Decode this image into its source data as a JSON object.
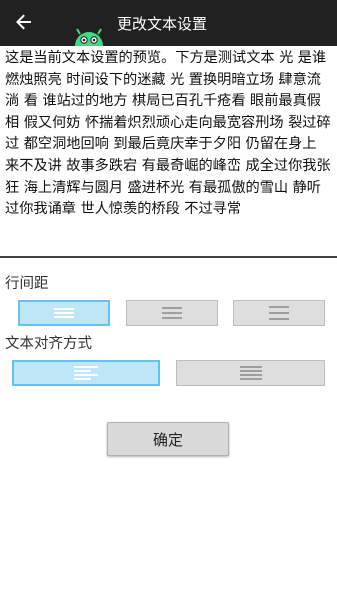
{
  "appbar": {
    "title": "更改文本设置",
    "back_icon": "arrow-left-icon",
    "logo_icon": "android-robot-icon"
  },
  "preview": {
    "text": "这是当前文本设置的预览。下方是测试文本 光 是谁燃烛照亮 时间设下的迷藏 光 置换明暗立场 肆意流淌 看 谁站过的地方 棋局已百孔千疮看 眼前最真假相 假又何妨 怀揣着炽烈顽心走向最宽容刑场 裂过碎过 都空洞地回响 到最后竟庆幸于夕阳 仍留在身上 来不及讲 故事多跌宕 有最奇崛的峰峦 成全过你我张狂 海上清辉与圆月 盛进杯光 有最孤傲的雪山 静听过你我诵章 世人惊羡的桥段 不过寻常"
  },
  "line_spacing": {
    "label": "行间距",
    "options": [
      {
        "icon": "line-spacing-small-icon",
        "selected": true
      },
      {
        "icon": "line-spacing-medium-icon",
        "selected": false
      },
      {
        "icon": "line-spacing-large-icon",
        "selected": false
      }
    ]
  },
  "alignment": {
    "label": "文本对齐方式",
    "options": [
      {
        "icon": "align-left-icon",
        "selected": true
      },
      {
        "icon": "align-justify-icon",
        "selected": false
      }
    ]
  },
  "confirm": {
    "label": "确定"
  },
  "colors": {
    "appbar_bg": "#212121",
    "selected_bg": "#bfe6f7",
    "selected_border": "#63c3ea",
    "unselected_bg": "#dedede",
    "icon_color": "#9e9e9e"
  }
}
